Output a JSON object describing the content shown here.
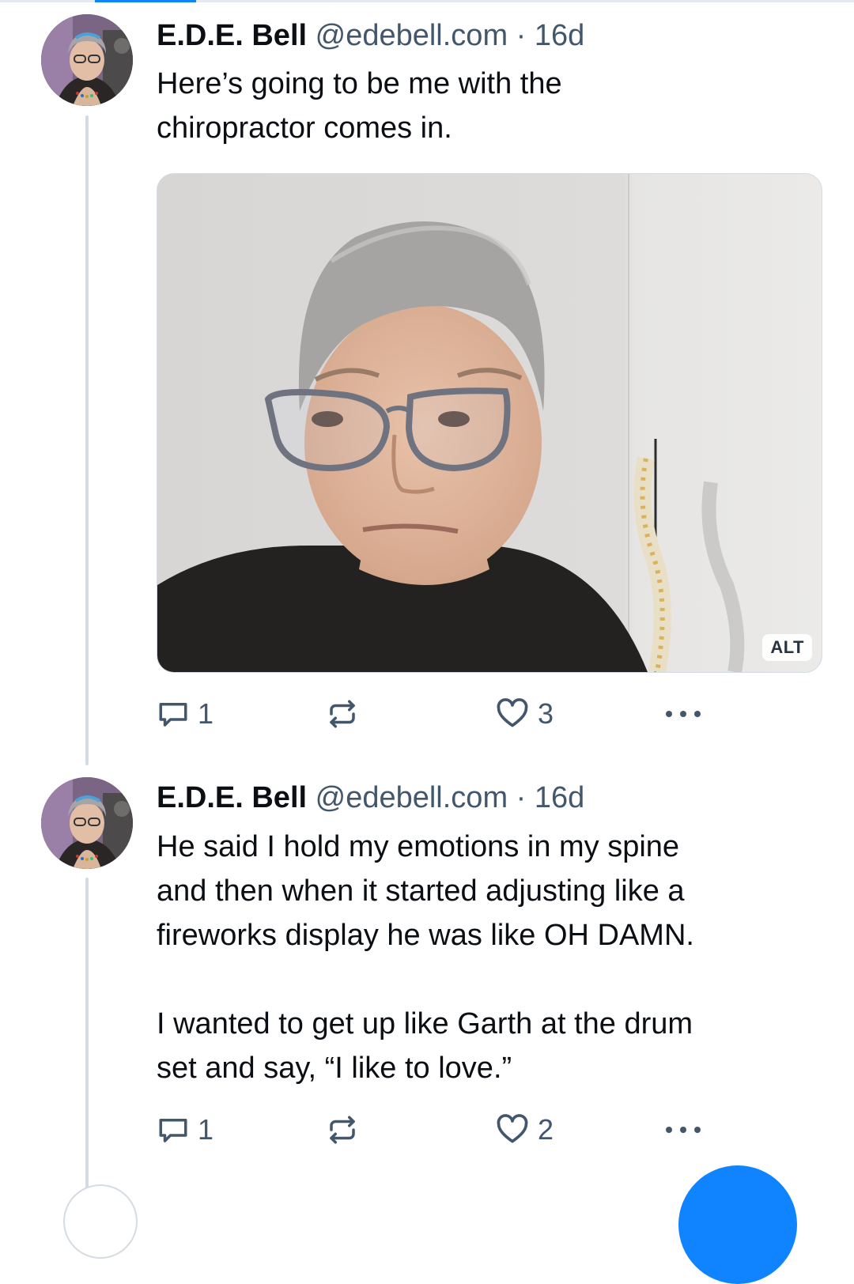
{
  "posts": [
    {
      "author": "E.D.E. Bell",
      "handle": "@edebell.com",
      "separator": "·",
      "age": "16d",
      "text": "Here’s going to be me with the\nchiropractor comes in.",
      "image_alt_badge": "ALT",
      "reply_count": "1",
      "like_count": "3"
    },
    {
      "author": "E.D.E. Bell",
      "handle": "@edebell.com",
      "separator": "·",
      "age": "16d",
      "text": "He said I hold my emotions in my spine\nand then when it started adjusting like a\nfireworks display he was like OH DAMN.\n\nI wanted to get up like Garth at the drum\nset and say, “I like to love.”",
      "reply_count": "1",
      "like_count": "2"
    }
  ],
  "icons": {
    "reply": "speech-bubble-icon",
    "repost": "repost-arrows-icon",
    "like": "heart-outline-icon",
    "more": "more-dots-icon"
  },
  "colors": {
    "accent": "#1083fe",
    "muted": "#42576c",
    "thread_line": "#d4dbe2"
  }
}
